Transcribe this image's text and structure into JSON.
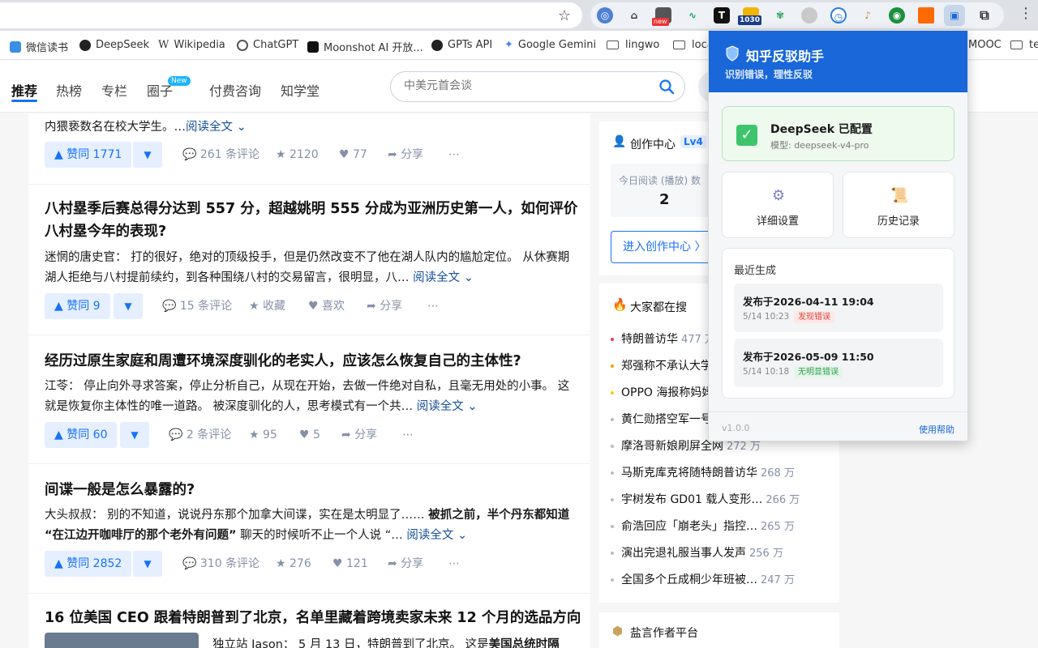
{
  "browser": {
    "extensions": {
      "badge_new": "new",
      "badge_count": "1030"
    },
    "bookmarks": [
      "微信读书",
      "DeepSeek",
      "Wikipedia",
      "ChatGPT",
      "Moonshot AI 开放...",
      "GPTs API",
      "Google Gemini",
      "lingwo",
      "loca",
      "MOOC",
      "te"
    ]
  },
  "nav": {
    "tabs": [
      "推荐",
      "热榜",
      "专栏",
      "圈子",
      "付费咨询",
      "知学堂"
    ],
    "new_badge": "New",
    "search_placeholder": "中美元首会谈"
  },
  "feed": {
    "items": [
      {
        "title": "",
        "excerpt": "内猥亵数名在校大学生。…",
        "read_more": "阅读全文 ⌄",
        "upvote": "▲ 赞同 1771",
        "comments": "261 条评论",
        "favorite": "2120",
        "like": "77",
        "share": "分享"
      },
      {
        "title": "八村塁季后赛总得分达到 557 分，超越姚明 555 分成为亚洲历史第一人，如何评价八村塁今年的表现?",
        "excerpt": "迷惘的唐史官： 打的很好，绝对的顶级投手，但是仍然改变不了他在湖人队内的尴尬定位。 从休赛期湖人拒绝与八村提前续约，到各种围绕八村的交易留言，很明显，八…",
        "read_more": "阅读全文 ⌄",
        "upvote": "▲ 赞同 9",
        "comments": "15 条评论",
        "favorite": "收藏",
        "like": "喜欢",
        "share": "分享"
      },
      {
        "title": "经历过原生家庭和周遭环境深度驯化的老实人，应该怎么恢复自己的主体性?",
        "excerpt": "江苓： 停止向外寻求答案，停止分析自己，从现在开始，去做一件绝对自私，且毫无用处的小事。 这就是恢复你主体性的唯一道路。 被深度驯化的人，思考模式有一个共…",
        "read_more": "阅读全文 ⌄",
        "upvote": "▲ 赞同 60",
        "comments": "2 条评论",
        "favorite": "95",
        "like": "5",
        "share": "分享"
      },
      {
        "title": "间谍一般是怎么暴露的?",
        "excerpt_a": "大头叔叔： 别的不知道，说说丹东那个加拿大间谍，实在是太明显了…… ",
        "excerpt_b": "被抓之前，半个丹东都知道 “在江边开咖啡厅的那个老外有问题”",
        "excerpt_c": " 聊天的时候听不止一个人说 “…",
        "read_more": "阅读全文 ⌄",
        "upvote": "▲ 赞同 2852",
        "comments": "310 条评论",
        "favorite": "276",
        "like": "121",
        "share": "分享"
      },
      {
        "title": "16 位美国 CEO 跟着特朗普到了北京，名单里藏着跨境卖家未来 12 个月的选品方向",
        "excerpt_a": "独立站 Jason： 5 月 13 日，特朗普到了北京。 这是",
        "excerpt_b": "美国总统时隔"
      }
    ]
  },
  "sidebar": {
    "creator": {
      "title": "创作中心",
      "level": "Lv4",
      "stat_label": "今日阅读 (播放) 数",
      "stat_value": "2",
      "enter_button": "进入创作中心 〉"
    },
    "hot": {
      "title": "大家都在搜",
      "items": [
        {
          "text": "特朗普访华",
          "heat": "477 万"
        },
        {
          "text": "郑强称不承认大学",
          "heat": ""
        },
        {
          "text": "OPPO 海报称妈妈",
          "heat": ""
        },
        {
          "text": "黄仁勋搭空军一号",
          "heat": ""
        },
        {
          "text": "摩洛哥新娘刷屏全网",
          "heat": "272 万"
        },
        {
          "text": "马斯克库克将随特朗普访华",
          "heat": "268 万"
        },
        {
          "text": "宇树发布 GD01 载人变形…",
          "heat": "266 万"
        },
        {
          "text": "俞浩回应「崩老头」指控…",
          "heat": "265 万"
        },
        {
          "text": "演出完退礼服当事人发声",
          "heat": "256 万"
        },
        {
          "text": "全国多个丘成桐少年班被…",
          "heat": "247 万"
        }
      ]
    },
    "footer_card": "盐言作者平台"
  },
  "popup": {
    "title": "知乎反驳助手",
    "subtitle": "识别错误，理性反驳",
    "status": {
      "name": "DeepSeek 已配置",
      "model": "模型: deepseek-v4-pro"
    },
    "settings_label": "详细设置",
    "history_label": "历史记录",
    "recent_title": "最近生成",
    "records": [
      {
        "title": "发布于2026-04-11 19:04",
        "date": "5/14 10:23",
        "badge": "发现错误",
        "badge_fg": "#e0463a",
        "badge_bg": "#fde8e6"
      },
      {
        "title": "发布于2026-05-09 11:50",
        "date": "5/14 10:18",
        "badge": "无明显错误",
        "badge_fg": "#2f9e4f",
        "badge_bg": "#e3f6e8"
      }
    ],
    "version": "v1.0.0",
    "help": "使用帮助"
  },
  "colors": {
    "accent": "#1772f6",
    "popup_header": "#1967d9",
    "success": "#3ec46d"
  }
}
